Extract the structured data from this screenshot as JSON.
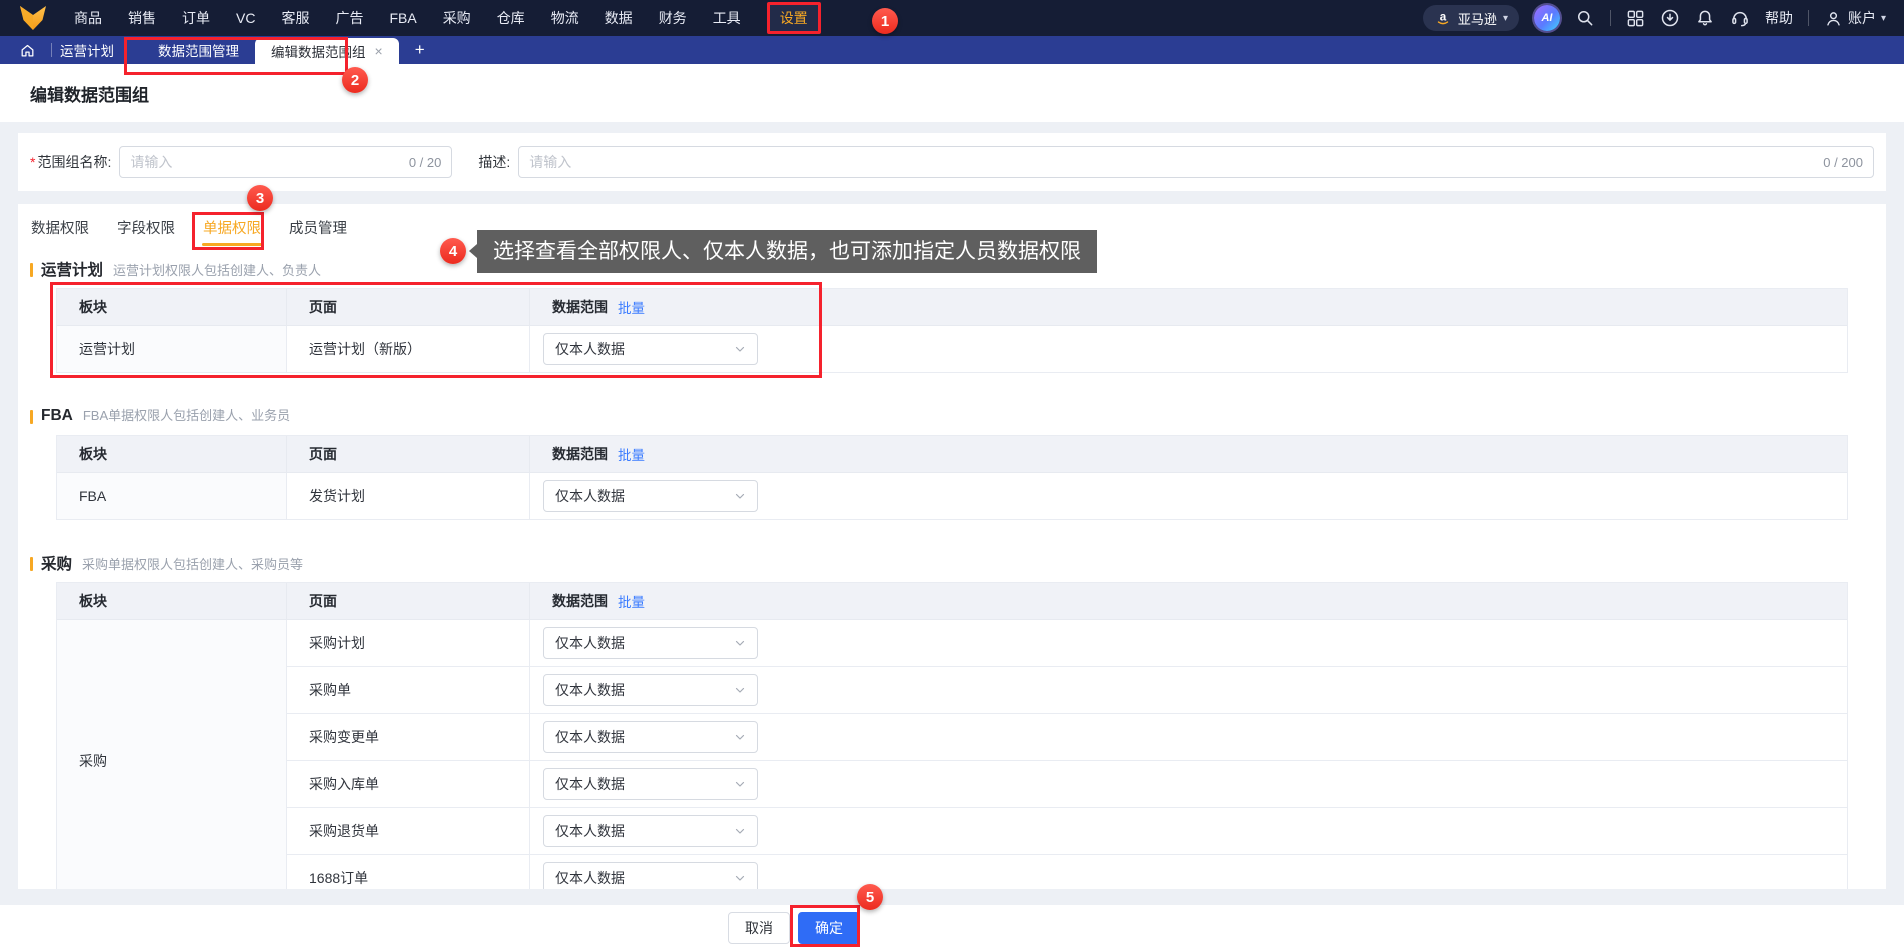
{
  "colors": {
    "accent_orange": "#F7A823",
    "primary_blue": "#2F6CF6",
    "link_blue": "#3B7CFF",
    "annotation_red": "#F5222D",
    "nav_bg": "#151D35",
    "tabbar_bg": "#2B3D93",
    "tooltip_bg": "#5F5F5F"
  },
  "nav": {
    "items": [
      "商品",
      "销售",
      "订单",
      "VC",
      "客服",
      "广告",
      "FBA",
      "采购",
      "仓库",
      "物流",
      "数据",
      "财务",
      "工具",
      "设置"
    ],
    "active_item": "设置",
    "right": {
      "marketplace": "亚马逊",
      "ai_label": "AI",
      "help": "帮助",
      "account": "账户"
    }
  },
  "tabbar": {
    "breadcrumb": "运营计划",
    "tab_inactive": "数据范围管理",
    "tab_active": "编辑数据范围组",
    "close": "×",
    "plus": "+"
  },
  "page_title": "编辑数据范围组",
  "form": {
    "name_label": "范围组名称:",
    "name_required_mark": "*",
    "name_placeholder": "请输入",
    "name_counter": "0 / 20",
    "desc_label": "描述:",
    "desc_placeholder": "请输入",
    "desc_counter": "0 / 200"
  },
  "perm_tabs": {
    "tab_1": "数据权限",
    "tab_2": "字段权限",
    "tab_3": "单据权限",
    "tab_4": "成员管理",
    "active": "单据权限"
  },
  "tooltip": {
    "text": "选择查看全部权限人、仅本人数据，也可添加指定人员数据权限"
  },
  "table_headers": {
    "module": "板块",
    "page": "页面",
    "scope": "数据范围",
    "batch": "批量"
  },
  "sections": [
    {
      "title": "运营计划",
      "subtitle": "运营计划权限人包括创建人、负责人",
      "rows": [
        {
          "module": "运营计划",
          "page": "运营计划（新版）",
          "scope": "仅本人数据"
        }
      ]
    },
    {
      "title": "FBA",
      "subtitle": "FBA单据权限人包括创建人、业务员",
      "rows": [
        {
          "module": "FBA",
          "page": "发货计划",
          "scope": "仅本人数据"
        }
      ]
    },
    {
      "title": "采购",
      "subtitle": "采购单据权限人包括创建人、采购员等",
      "module": "采购",
      "rows": [
        {
          "page": "采购计划",
          "scope": "仅本人数据"
        },
        {
          "page": "采购单",
          "scope": "仅本人数据"
        },
        {
          "page": "采购变更单",
          "scope": "仅本人数据"
        },
        {
          "page": "采购入库单",
          "scope": "仅本人数据"
        },
        {
          "page": "采购退货单",
          "scope": "仅本人数据"
        },
        {
          "page": "1688订单",
          "scope": "仅本人数据"
        }
      ]
    }
  ],
  "footer": {
    "cancel": "取消",
    "confirm": "确定"
  },
  "annotations": {
    "badge_1": "1",
    "badge_2": "2",
    "badge_3": "3",
    "badge_4": "4",
    "badge_5": "5"
  }
}
